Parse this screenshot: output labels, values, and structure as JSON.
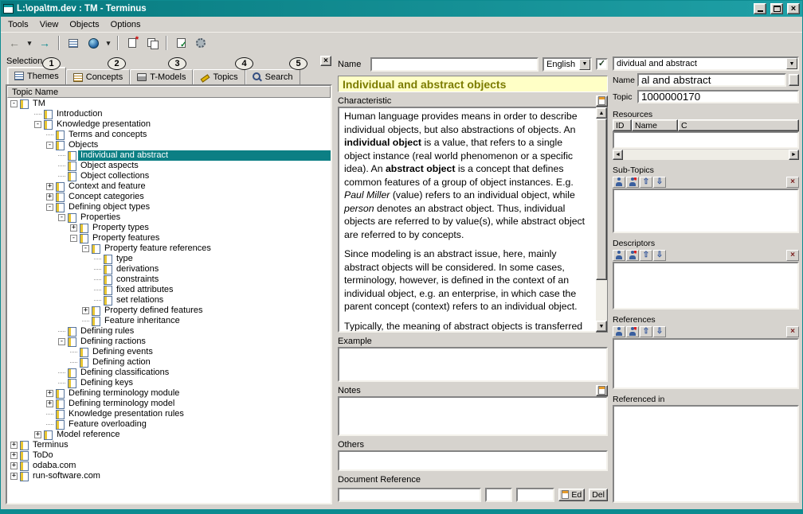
{
  "colors": {
    "face": "#d6d3ce",
    "titlebar_a": "#077a7f",
    "titlebar_b": "#1fa0a6",
    "selection": "#0c7f84",
    "topic_title_bg": "#ffffc6",
    "topic_title_fg": "#7c7c00",
    "window_border": "#0d8b90"
  },
  "icons": {
    "caret_down": "▼",
    "scroll_up": "▲",
    "scroll_down": "▼",
    "scroll_left": "◄",
    "scroll_right": "►",
    "close": "×"
  },
  "window": {
    "title": "L:\\opa\\tm.dev : TM - Terminus"
  },
  "menu": {
    "items": [
      "Tools",
      "View",
      "Objects",
      "Options"
    ]
  },
  "toolbar": {
    "items": [
      {
        "name": "back-button",
        "icon": "arrow-left-icon"
      },
      {
        "name": "back-history-dropdown",
        "icon": "caret-down-icon",
        "small": true
      },
      {
        "name": "forward-button",
        "icon": "arrow-right-icon"
      },
      {
        "sep": true
      },
      {
        "name": "topic-list-button",
        "icon": "outline-list-icon"
      },
      {
        "name": "globe-button",
        "icon": "globe-icon"
      },
      {
        "name": "view-options-dropdown",
        "icon": "caret-down-icon",
        "small": true
      },
      {
        "sep": true
      },
      {
        "name": "new-topic-button",
        "icon": "new-document-icon"
      },
      {
        "name": "copy-topic-button",
        "icon": "copy-document-icon"
      },
      {
        "sep": true
      },
      {
        "name": "check-document-button",
        "icon": "document-check-icon"
      },
      {
        "name": "process-button",
        "icon": "gear-icon"
      }
    ]
  },
  "selection": {
    "label": "Selection",
    "close_glyph": "×",
    "callouts": [
      "1",
      "2",
      "3",
      "4",
      "5"
    ],
    "tabs": [
      {
        "label": "Themes",
        "icon": "themes-icon",
        "active": true
      },
      {
        "label": "Concepts",
        "icon": "concepts-icon"
      },
      {
        "label": "T-Models",
        "icon": "tmodels-icon"
      },
      {
        "label": "Topics",
        "icon": "topics-icon"
      },
      {
        "label": "Search",
        "icon": "search-icon"
      }
    ],
    "tree_header": "Topic Name",
    "tree": [
      {
        "d": 0,
        "e": "-",
        "t": "TM"
      },
      {
        "d": 1,
        "t": "Introduction"
      },
      {
        "d": 1,
        "e": "-",
        "t": "Knowledge presentation"
      },
      {
        "d": 2,
        "t": "Terms and concepts"
      },
      {
        "d": 2,
        "e": "-",
        "t": "Objects"
      },
      {
        "d": 3,
        "t": "Individual and abstract",
        "sel": true
      },
      {
        "d": 3,
        "t": "Object aspects"
      },
      {
        "d": 3,
        "t": "Object collections"
      },
      {
        "d": 2,
        "e": "+",
        "t": "Context and feature"
      },
      {
        "d": 2,
        "e": "+",
        "t": "Concept categories"
      },
      {
        "d": 2,
        "e": "-",
        "t": "Defining object types"
      },
      {
        "d": 3,
        "e": "-",
        "t": "Properties"
      },
      {
        "d": 4,
        "e": "+",
        "t": "Property types"
      },
      {
        "d": 4,
        "e": "-",
        "t": "Property features"
      },
      {
        "d": 5,
        "e": "-",
        "t": "Property feature references"
      },
      {
        "d": 6,
        "t": "type"
      },
      {
        "d": 6,
        "t": "derivations"
      },
      {
        "d": 6,
        "t": "constraints"
      },
      {
        "d": 6,
        "t": "fixed attributes"
      },
      {
        "d": 6,
        "t": "set relations"
      },
      {
        "d": 5,
        "e": "+",
        "t": "Property defined features"
      },
      {
        "d": 5,
        "t": "Feature inheritance"
      },
      {
        "d": 3,
        "t": "Defining rules"
      },
      {
        "d": 3,
        "e": "-",
        "t": "Defining ractions"
      },
      {
        "d": 4,
        "t": "Defining events"
      },
      {
        "d": 4,
        "t": "Defining action"
      },
      {
        "d": 3,
        "t": "Defining classifications"
      },
      {
        "d": 3,
        "t": "Defining keys"
      },
      {
        "d": 2,
        "e": "+",
        "t": "Defining terminology module"
      },
      {
        "d": 2,
        "e": "+",
        "t": "Defining terminology model"
      },
      {
        "d": 2,
        "t": "Knowledge presentation rules"
      },
      {
        "d": 2,
        "t": "Feature overloading"
      },
      {
        "d": 1,
        "e": "+",
        "t": "Model reference"
      },
      {
        "d": 0,
        "e": "+",
        "t": "Terminus"
      },
      {
        "d": 0,
        "e": "+",
        "t": "ToDo"
      },
      {
        "d": 0,
        "e": "+",
        "t": "odaba.com"
      },
      {
        "d": 0,
        "e": "+",
        "t": "run-software.com"
      }
    ]
  },
  "detail": {
    "name_label": "Name",
    "name_value": "",
    "language_value": "English",
    "language_checked": "✓",
    "title": "Individual and abstract objects",
    "sections": {
      "characteristic": "Characteristic",
      "example": "Example",
      "notes": "Notes",
      "others": "Others",
      "document_reference": "Document Reference"
    },
    "characteristic_paragraphs": [
      [
        {
          "t": "Human language provides means in order to describe individual objects, but also abstractions of objects. An "
        },
        {
          "t": "individual object",
          "b": 1
        },
        {
          "t": " is a value, that refers to a single object instance (real world phenomenon or a specific idea). An "
        },
        {
          "t": "abstract object",
          "b": 1
        },
        {
          "t": " is a concept that defines common features of a group of object instances. E.g. "
        },
        {
          "t": "Paul Miller",
          "i": 1
        },
        {
          "t": " (value) refers to an individual object, while "
        },
        {
          "t": "person",
          "i": 1
        },
        {
          "t": " denotes an abstract object. Thus, individual objects are referred to by value(s), while abstract object are referred to by concepts."
        }
      ],
      [
        {
          "t": "Since modeling is an abstract issue, here, mainly abstract objects will be considered. In some cases, terminology, however, is defined in the context of an individual object, e.g. an enterprise, in which case the parent concept (context) refers to an individual object."
        }
      ],
      [
        {
          "t": "Typically, the meaning of abstract objects is transferred by means of examples (\"This is a tree\"). After being introduced to a sufficient"
        }
      ]
    ],
    "docref_value": "",
    "docref_field2": "",
    "docref_field3": "",
    "edit_label": "Ed",
    "delete_label": "Del"
  },
  "sidebar": {
    "topic_combo_value": "dividual and abstract",
    "name_label": "Name",
    "name_value": "al and abstract",
    "topic_label": "Topic",
    "topic_value": "1000000170",
    "resources_label": "Resources",
    "resources_columns": [
      "ID",
      "Name",
      "C"
    ],
    "subtopics_label": "Sub-Topics",
    "descriptors_label": "Descriptors",
    "references_label": "References",
    "referenced_in_label": "Referenced in",
    "section_icons": [
      "person-add-icon",
      "person-new-icon",
      "move-up-icon",
      "move-down-icon",
      "remove-icon"
    ]
  }
}
